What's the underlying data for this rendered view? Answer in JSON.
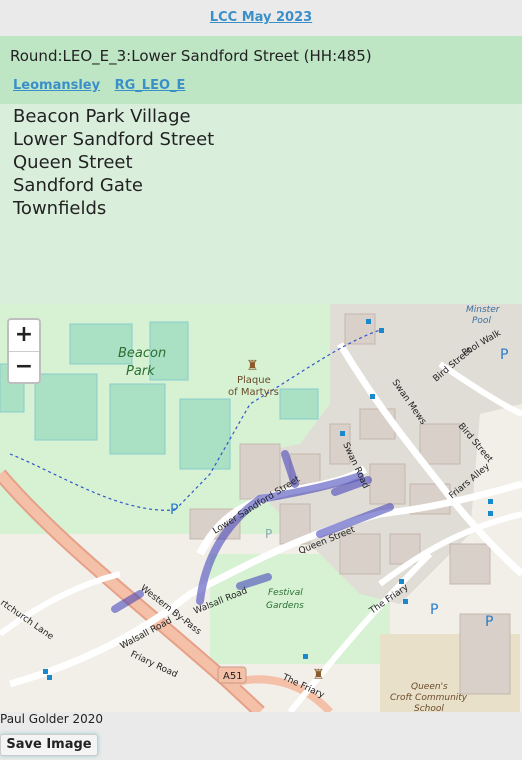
{
  "header": {
    "link": "LCC May 2023"
  },
  "round": {
    "title": "Round:LEO_E_3:Lower Sandford Street (HH:485)",
    "links": [
      "Leomansley",
      "RG_LEO_E"
    ]
  },
  "streets": [
    "Beacon Park Village",
    "Lower Sandford Street",
    "Queen Street",
    "Sandford Gate",
    "Townfields"
  ],
  "map": {
    "zoom_in": "+",
    "zoom_out": "−",
    "labels": {
      "beacon_park": "Beacon\nPark",
      "plaque": "Plaque",
      "of_martyrs": "of Martyrs",
      "lower_sandford": "Lower Sandford Street",
      "queen_street": "Queen Street",
      "western_bypass": "Western By-Pass",
      "walsall_road": "Walsall Road",
      "walsall_road2": "Walsall Road",
      "friary_road": "Friary Road",
      "festival": "Festival",
      "gardens": "Gardens",
      "swan_road": "Swan Road",
      "swan_mews": "Swan Mews",
      "bird_street": "Bird Street",
      "bird_street2": "Bird Street",
      "friars_alley": "Friars Alley",
      "the_friary": "The Friary",
      "the_friary2": "The Friary",
      "a51": "A51",
      "minster": "Minster",
      "pool": "Pool",
      "pool_walk": "Pool Walk",
      "queens": "Queen's",
      "croft": "Croft Community",
      "school": "School",
      "church_lane": "rtchurch Lane",
      "parking": "P"
    },
    "colors": {
      "route": "#3b3bb8",
      "park": "#c8f0cc",
      "road_major": "#e8a080",
      "water": "#aad3df"
    }
  },
  "footer": {
    "credit": "Paul Golder 2020",
    "save_label": "Save Image"
  }
}
